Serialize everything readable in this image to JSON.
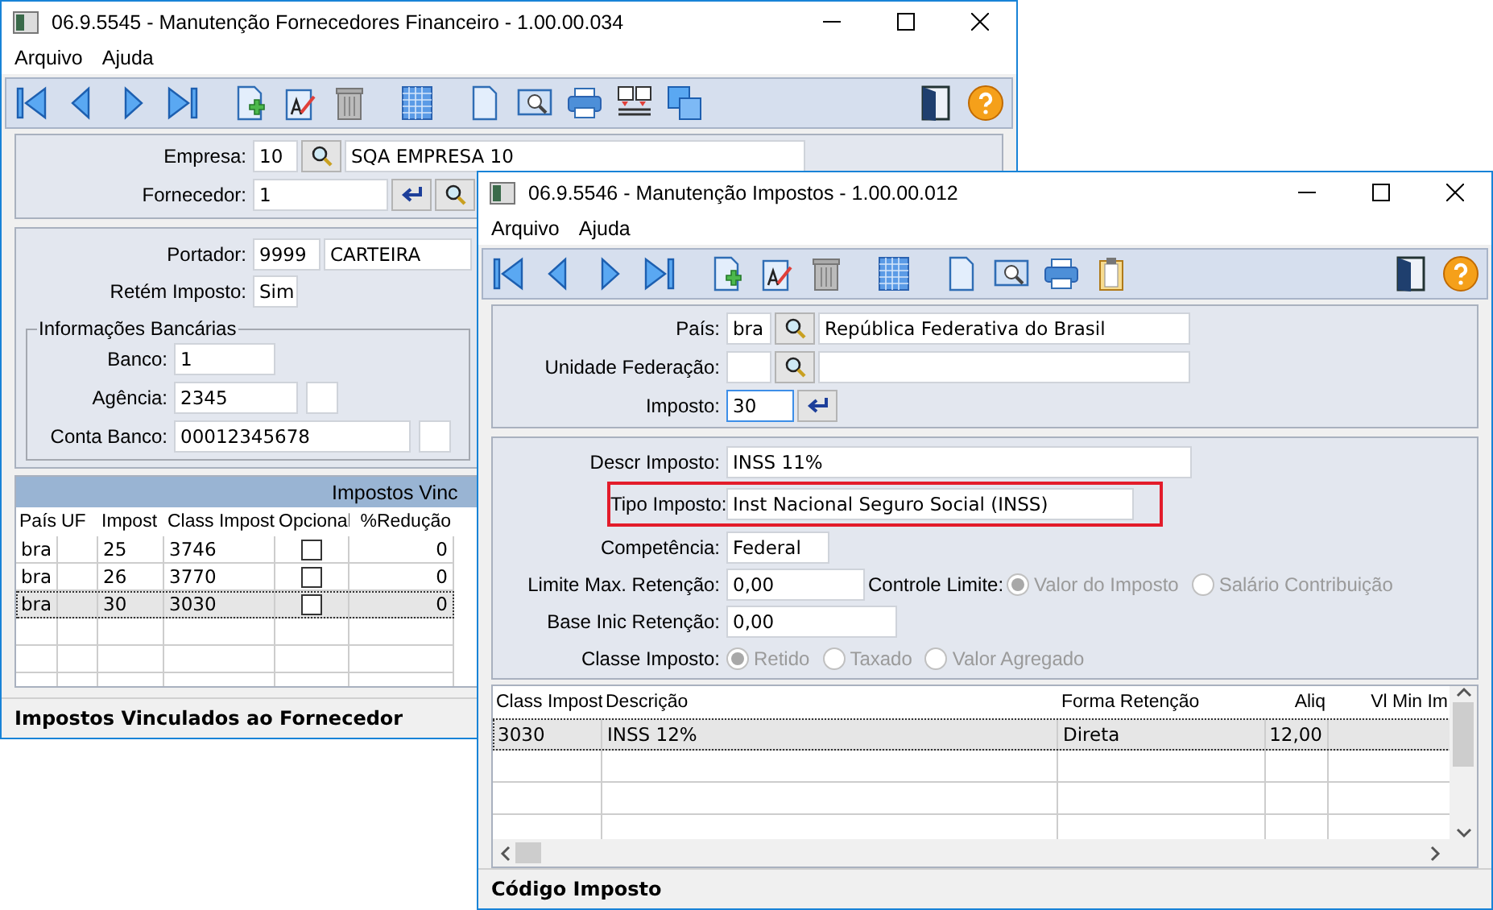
{
  "back_window": {
    "title": "06.9.5545 - Manutenção Fornecedores Financeiro - 1.00.00.034",
    "menu": [
      "Arquivo",
      "Ajuda"
    ],
    "empresa": {
      "label": "Empresa:",
      "code": "10",
      "name": "SQA EMPRESA 10"
    },
    "fornecedor": {
      "label": "Fornecedor:",
      "code": "1"
    },
    "portador": {
      "label": "Portador:",
      "code": "9999",
      "name": "CARTEIRA"
    },
    "retem_imposto": {
      "label": "Retém Imposto:",
      "value": "Sim"
    },
    "bank_group": {
      "title": "Informações Bancárias",
      "fields": [
        {
          "label": "Banco:",
          "value": "1",
          "has_digit": false
        },
        {
          "label": "Agência:",
          "value": "2345",
          "has_digit": true
        },
        {
          "label": "Conta Banco:",
          "value": "00012345678",
          "has_digit": true
        }
      ]
    },
    "table": {
      "title": "Impostos Vinc",
      "columns": [
        "País",
        "UF",
        "Impost",
        "Class Impost",
        "Opcional",
        "%Redução"
      ],
      "rows": [
        {
          "pais": "bra",
          "imposto": "25",
          "class_imposto": "3746",
          "opcional": false,
          "reducao": "0",
          "selected": false
        },
        {
          "pais": "bra",
          "imposto": "26",
          "class_imposto": "3770",
          "opcional": false,
          "reducao": "0",
          "selected": false
        },
        {
          "pais": "bra",
          "imposto": "30",
          "class_imposto": "3030",
          "opcional": false,
          "reducao": "0",
          "selected": true
        }
      ]
    },
    "status_bar": "Impostos Vinculados ao Fornecedor"
  },
  "front_window": {
    "title": "06.9.5546 - Manutenção Impostos - 1.00.00.012",
    "menu": [
      "Arquivo",
      "Ajuda"
    ],
    "pais": {
      "label": "País:",
      "code": "bra",
      "name": "República Federativa do Brasil"
    },
    "uf": {
      "label": "Unidade Federação:"
    },
    "imposto": {
      "label": "Imposto:",
      "code": "30",
      "focused": true
    },
    "descr_imposto": {
      "label": "Descr Imposto:",
      "value": "INSS 11%"
    },
    "tipo_imposto": {
      "label": "Tipo Imposto:",
      "value": "Inst Nacional Seguro Social (INSS)",
      "highlighted": true
    },
    "competencia": {
      "label": "Competência:",
      "value": "Federal"
    },
    "limite_max": {
      "label": "Limite Max. Retenção:",
      "value": "0,00"
    },
    "controle_limite": {
      "label": "Controle Limite:",
      "disabled": true,
      "options": [
        {
          "label": "Valor do Imposto",
          "selected": true
        },
        {
          "label": "Salário Contribuição",
          "selected": false
        }
      ]
    },
    "base_inic": {
      "label": "Base Inic Retenção:",
      "value": "0,00"
    },
    "classe_imposto": {
      "label": "Classe Imposto:",
      "disabled": true,
      "options": [
        {
          "label": "Retido",
          "selected": true
        },
        {
          "label": "Taxado",
          "selected": false
        },
        {
          "label": "Valor Agregado",
          "selected": false
        }
      ]
    },
    "table": {
      "columns": [
        "Class Impost",
        "Descrição",
        "Forma Retenção",
        "Aliq",
        "Vl Min Im"
      ],
      "rows": [
        {
          "class_imposto": "3030",
          "descricao": "INSS 12%",
          "forma_retencao": "Direta",
          "aliq": "12,00",
          "selected": true
        }
      ]
    },
    "status_bar": "Código Imposto"
  }
}
